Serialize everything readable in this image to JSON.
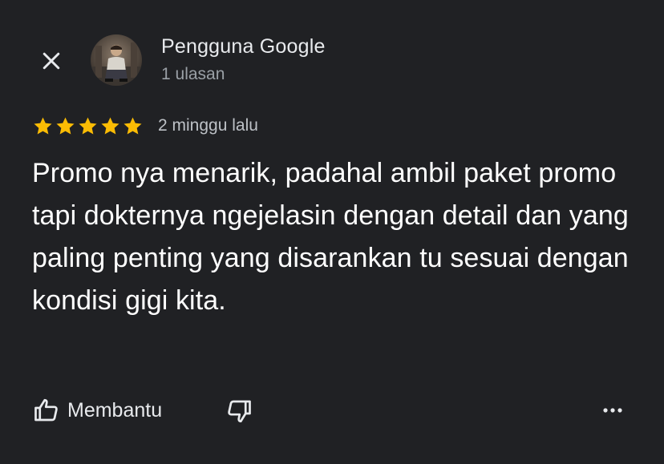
{
  "author": {
    "name": "Pengguna Google",
    "review_count": "1 ulasan"
  },
  "review": {
    "rating": 5,
    "max_rating": 5,
    "date": "2 minggu lalu",
    "text": "Promo nya menarik, padahal ambil paket promo tapi dokternya ngejelasin dengan detail dan yang paling penting yang disarankan tu sesuai dengan kondisi gigi kita."
  },
  "actions": {
    "helpful_label": "Membantu"
  },
  "icons": {
    "close": "close-icon",
    "thumbs_up": "thumbs-up-icon",
    "thumbs_down": "thumbs-down-icon",
    "more": "more-horizontal-icon",
    "star": "star-icon"
  },
  "colors": {
    "background": "#202124",
    "star": "#fbbc04",
    "text_primary": "#e8eaed",
    "text_secondary": "#9aa0a6"
  }
}
